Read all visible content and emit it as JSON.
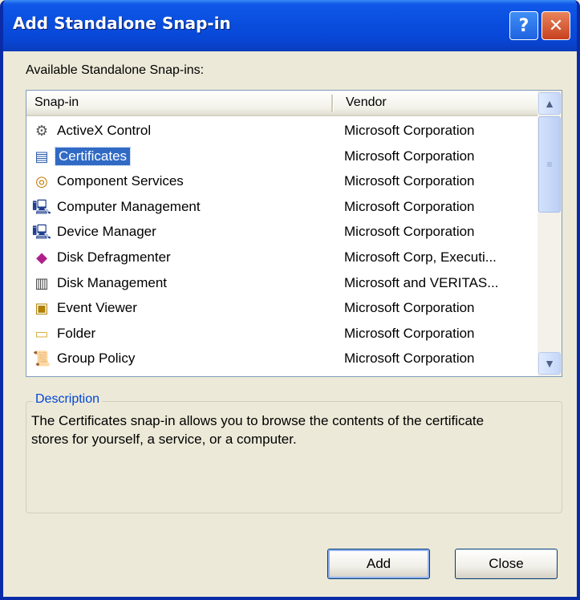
{
  "window": {
    "title": "Add Standalone Snap-in",
    "help_glyph": "?",
    "close_glyph": "✕"
  },
  "available_label": "Available Standalone Snap-ins:",
  "list": {
    "columns": {
      "snapin": "Snap-in",
      "vendor": "Vendor"
    },
    "selected_index": 1,
    "rows": [
      {
        "name": "ActiveX Control",
        "vendor": "Microsoft Corporation",
        "icon": "activex-control-icon",
        "glyph": "⚙"
      },
      {
        "name": "Certificates",
        "vendor": "Microsoft Corporation",
        "icon": "certificates-icon",
        "glyph": "▤"
      },
      {
        "name": "Component Services",
        "vendor": "Microsoft Corporation",
        "icon": "component-services-icon",
        "glyph": "◎"
      },
      {
        "name": "Computer Management",
        "vendor": "Microsoft Corporation",
        "icon": "computer-management-icon",
        "glyph": "🖳"
      },
      {
        "name": "Device Manager",
        "vendor": "Microsoft Corporation",
        "icon": "device-manager-icon",
        "glyph": "🖳"
      },
      {
        "name": "Disk Defragmenter",
        "vendor": "Microsoft Corp, Executi...",
        "icon": "disk-defragmenter-icon",
        "glyph": "◆"
      },
      {
        "name": "Disk Management",
        "vendor": "Microsoft and VERITAS...",
        "icon": "disk-management-icon",
        "glyph": "▥"
      },
      {
        "name": "Event Viewer",
        "vendor": "Microsoft Corporation",
        "icon": "event-viewer-icon",
        "glyph": "▣"
      },
      {
        "name": "Folder",
        "vendor": "Microsoft Corporation",
        "icon": "folder-icon",
        "glyph": "▭"
      },
      {
        "name": "Group Policy",
        "vendor": "Microsoft Corporation",
        "icon": "group-policy-icon",
        "glyph": "📜"
      }
    ],
    "scroll": {
      "up_glyph": "▲",
      "down_glyph": "▼",
      "thumb_glyph": "≡"
    }
  },
  "description": {
    "legend": "Description",
    "text": "The Certificates snap-in allows you to browse the contents of the certificate stores for yourself, a service, or a computer."
  },
  "buttons": {
    "add": "Add",
    "close": "Close"
  },
  "colors": {
    "titlebar": "#0a4fe0",
    "selection": "#316ac5",
    "legend": "#0046d5",
    "face": "#ece9d8"
  }
}
